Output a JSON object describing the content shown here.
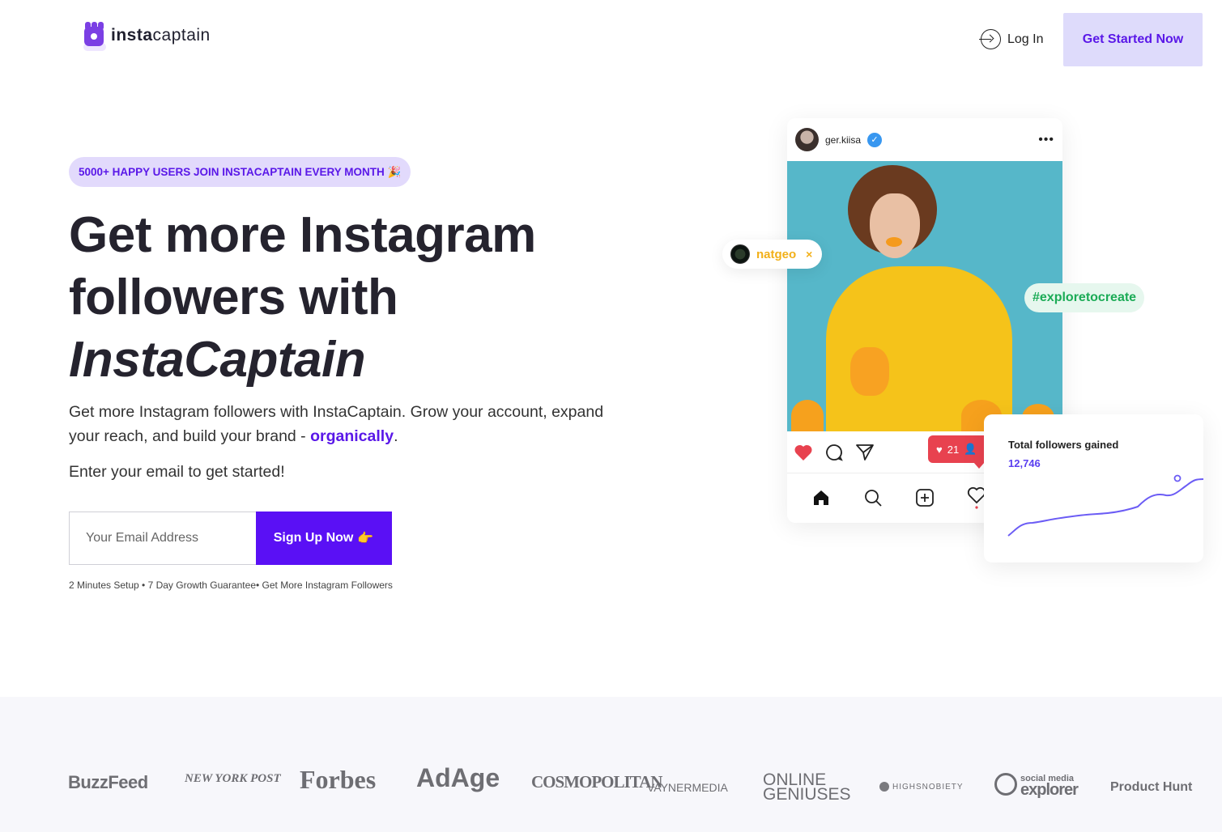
{
  "brand": {
    "name_bold": "insta",
    "name_light": "captain"
  },
  "nav": {
    "login_label": "Log In",
    "cta_label": "Get Started Now"
  },
  "hero": {
    "badge": "5000+ HAPPY USERS JOIN INSTACAPTAIN EVERY MONTH 🎉",
    "headline_line1": "Get more Instagram",
    "headline_line2": "followers with",
    "headline_line3": "InstaCaptain",
    "lead_text": "Get more Instagram followers with InstaCaptain. Grow your account, expand your reach, and build your brand - ",
    "lead_highlight": "organically",
    "lead_end": ".",
    "prompt": "Enter your email to get started!",
    "email_placeholder": "Your Email Address",
    "signup_label": "Sign Up Now",
    "signup_emoji": "👈",
    "fineprint": "2 Minutes Setup • 7 Day Growth Guarantee• Get More Instagram Followers"
  },
  "post": {
    "username": "ger.kiisa",
    "verified_icon": "check",
    "more_icon": "•••",
    "like_count": "21",
    "tag_user": "natgeo",
    "tag_close": "×",
    "hashtag": "#exploretocreate"
  },
  "followers_card": {
    "title": "Total followers gained",
    "value": "12,746",
    "line_color": "#6b5cf5"
  },
  "press": [
    "BuzzFeed",
    "NEW YORK POST",
    "Forbes",
    "AdAge",
    "COSMOPOLITAN",
    "VAYNERMEDIA",
    "ONLINE",
    "GENIUSES",
    "HIGHSNOBIETY",
    "social media",
    "explorer",
    "Product Hunt"
  ],
  "colors": {
    "accent": "#5a10f5",
    "accent_soft": "#dedbfb",
    "like_red": "#e8424f",
    "hashtag_green": "#1bab56",
    "natgeo_yellow": "#f2b019"
  }
}
